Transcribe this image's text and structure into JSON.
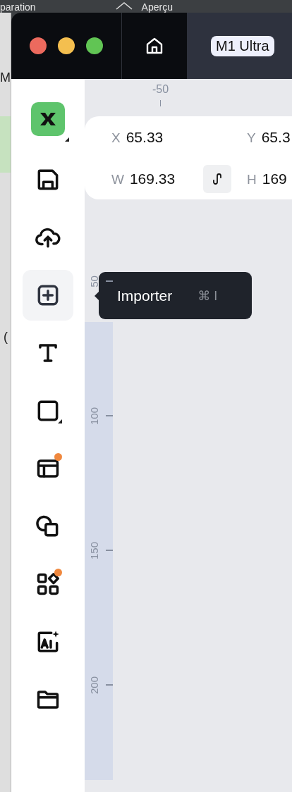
{
  "background_window": {
    "texts": [
      "paration",
      "Aperçu"
    ],
    "side_texts": [
      "M",
      "("
    ]
  },
  "window": {
    "title_chip": "M1 Ultra"
  },
  "toolbar": [
    {
      "kind": "logo",
      "selected": false,
      "has_menu": true,
      "badge": false
    },
    {
      "kind": "save",
      "selected": false,
      "has_menu": false,
      "badge": false
    },
    {
      "kind": "upload",
      "selected": false,
      "has_menu": false,
      "badge": false
    },
    {
      "kind": "import",
      "selected": true,
      "has_menu": false,
      "badge": false
    },
    {
      "kind": "text",
      "selected": false,
      "has_menu": false,
      "badge": false
    },
    {
      "kind": "rectangle",
      "selected": false,
      "has_menu": true,
      "badge": false
    },
    {
      "kind": "layout",
      "selected": false,
      "has_menu": false,
      "badge": true
    },
    {
      "kind": "shapes",
      "selected": false,
      "has_menu": false,
      "badge": false
    },
    {
      "kind": "components",
      "selected": false,
      "has_menu": false,
      "badge": true
    },
    {
      "kind": "ai",
      "selected": false,
      "has_menu": false,
      "badge": false
    },
    {
      "kind": "folder",
      "selected": false,
      "has_menu": false,
      "badge": false
    }
  ],
  "tooltip": {
    "label": "Importer",
    "shortcut": "⌘ I"
  },
  "ruler": {
    "top_labels": [
      "-50"
    ],
    "left_labels": [
      "50",
      "100",
      "150",
      "200"
    ]
  },
  "properties": {
    "fields": [
      {
        "label": "X",
        "value": "65.33"
      },
      {
        "label": "Y",
        "value": "65.3"
      },
      {
        "label": "W",
        "value": "169.33"
      },
      {
        "label": "H",
        "value": "169"
      }
    ]
  }
}
